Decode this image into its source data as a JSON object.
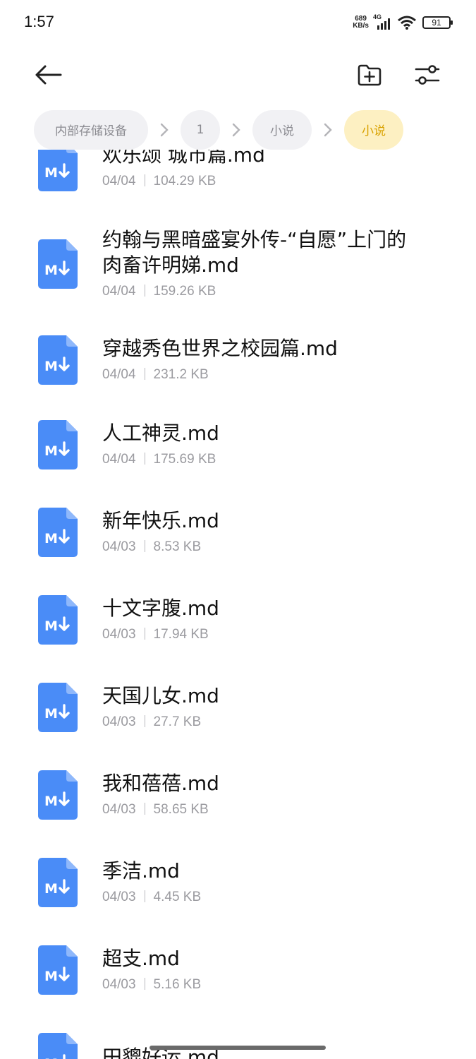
{
  "status_bar": {
    "time": "1:57",
    "net_speed_value": "689",
    "net_speed_unit": "KB/s",
    "network_type": "4G",
    "battery_level": "91",
    "icons": [
      "signal-icon",
      "wifi-icon",
      "battery-icon"
    ]
  },
  "toolbar": {
    "back_icon": "arrow-left-icon",
    "new_folder_icon": "folder-plus-icon",
    "settings_icon": "sliders-icon"
  },
  "breadcrumb": [
    {
      "label": "内部存储设备"
    },
    {
      "label": "1"
    },
    {
      "label": "小说"
    },
    {
      "label": "小说",
      "active": true
    }
  ],
  "colors": {
    "accent_icon": "#4a8cf7",
    "crumb_active_bg": "#fdf0c2",
    "crumb_active_text": "#d9a200",
    "meta_text": "#9b9ba0"
  },
  "files": [
    {
      "name": "欢乐颂 城市篇.md",
      "date": "04/04",
      "size": "104.29 KB"
    },
    {
      "name": "约翰与黑暗盛宴外传-“自愿”上门的肉畜许明娣.md",
      "date": "04/04",
      "size": "159.26 KB"
    },
    {
      "name": "穿越秀色世界之校园篇.md",
      "date": "04/04",
      "size": "231.2 KB"
    },
    {
      "name": "人工神灵.md",
      "date": "04/04",
      "size": "175.69 KB"
    },
    {
      "name": "新年快乐.md",
      "date": "04/03",
      "size": "8.53 KB"
    },
    {
      "name": "十文字腹.md",
      "date": "04/03",
      "size": "17.94 KB"
    },
    {
      "name": "天国儿女.md",
      "date": "04/03",
      "size": "27.7 KB"
    },
    {
      "name": "我和蓓蓓.md",
      "date": "04/03",
      "size": "58.65 KB"
    },
    {
      "name": "季洁.md",
      "date": "04/03",
      "size": "4.45 KB"
    },
    {
      "name": "超支.md",
      "date": "04/03",
      "size": "5.16 KB"
    },
    {
      "name": "田貔好运.md",
      "date": "",
      "size": ""
    }
  ]
}
